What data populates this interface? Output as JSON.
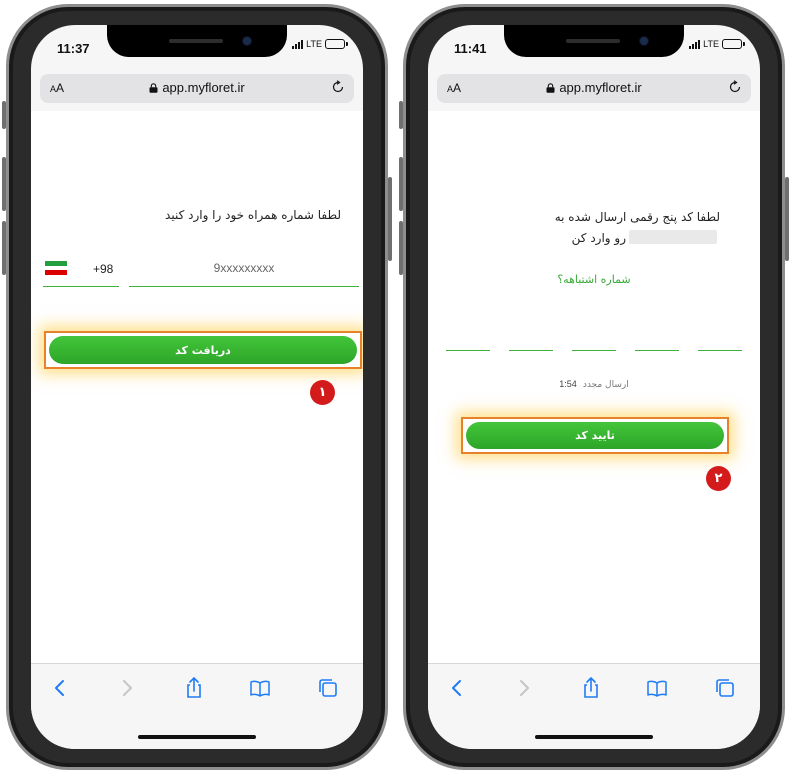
{
  "accent_color": "#3fae3b",
  "highlight_color": "#e8822a",
  "badge_color": "#d41b1b",
  "left_phone": {
    "status_time": "11:37",
    "network": "LTE",
    "url_aa_small": "A",
    "url_aa_large": "A",
    "url": "app.myfloret.ir",
    "instruction": "لطفا شماره همراه خود را وارد کنید",
    "country_code": "+98",
    "phone_placeholder": "9xxxxxxxxx",
    "submit_label": "دریافت کد",
    "step_badge": "۱"
  },
  "right_phone": {
    "status_time": "11:41",
    "network": "LTE",
    "url_aa_small": "A",
    "url_aa_large": "A",
    "url": "app.myfloret.ir",
    "instruction_line1": "لطفا کد پنج رقمی ارسال شده به",
    "instruction_line2": "رو وارد کن",
    "wrong_number_link": "شماره اشتباهه؟",
    "otp_count": 5,
    "resend_label": "ارسال مجدد",
    "resend_timer": "1:54",
    "confirm_label": "تایید کد",
    "step_badge": "۲"
  },
  "toolbar_icons": [
    "back-icon",
    "forward-icon",
    "share-icon",
    "bookmarks-icon",
    "tabs-icon"
  ]
}
